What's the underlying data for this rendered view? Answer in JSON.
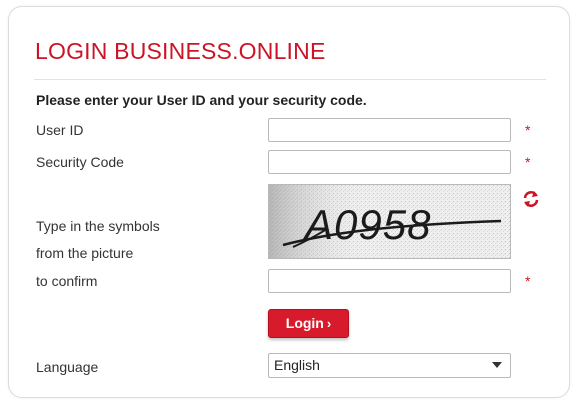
{
  "form": {
    "title": "LOGIN BUSINESS.ONLINE",
    "instruction": "Please enter your User ID and your security code.",
    "user_id_label": "User ID",
    "user_id_value": "",
    "security_code_label": "Security Code",
    "security_code_value": "",
    "captcha_label_line1": "Type in the symbols",
    "captcha_label_line2": "from the picture",
    "captcha_label_line3": "to confirm",
    "captcha_text": "A0958",
    "captcha_value": "",
    "required_marker": "*",
    "login_label": "Login",
    "login_chevron": "›",
    "language_label": "Language",
    "language_selected": "English"
  },
  "icons": {
    "refresh": "refresh-icon",
    "dropdown": "caret-down-icon"
  },
  "colors": {
    "brand_red": "#cc1426",
    "button_red": "#d81b2c",
    "border_gray": "#b9b9b9"
  }
}
